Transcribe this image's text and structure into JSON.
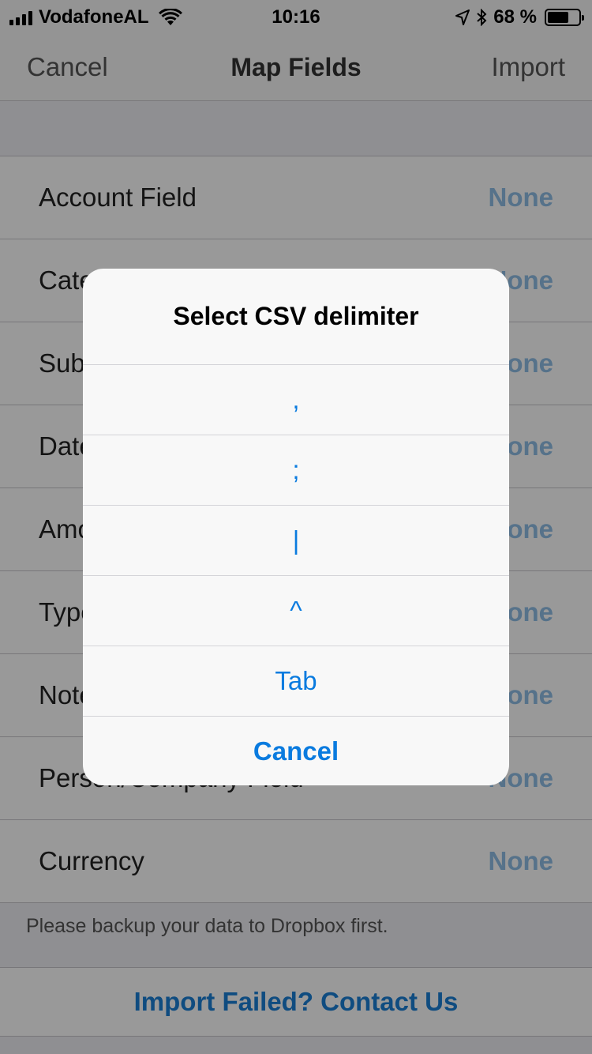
{
  "status_bar": {
    "carrier": "VodafoneAL",
    "time": "10:16",
    "battery": "68 %",
    "battery_level": 0.68
  },
  "nav": {
    "cancel": "Cancel",
    "title": "Map Fields",
    "import": "Import"
  },
  "fields": [
    {
      "label": "Account Field",
      "value": "None"
    },
    {
      "label": "Category Field",
      "value": "None"
    },
    {
      "label": "Subcategory Field",
      "value": "None"
    },
    {
      "label": "Date Field",
      "value": "None"
    },
    {
      "label": "Amount Field",
      "value": "None"
    },
    {
      "label": "Type Field",
      "value": "None"
    },
    {
      "label": "Notes Field",
      "value": "None"
    },
    {
      "label": "Person/Company Field",
      "value": "None"
    },
    {
      "label": "Currency",
      "value": "None"
    }
  ],
  "footer_note": "Please backup your data to Dropbox first.",
  "contact_link": "Import Failed? Contact Us",
  "alert": {
    "title": "Select CSV delimiter",
    "options": [
      ",",
      ";",
      "|",
      "^",
      "Tab"
    ],
    "cancel": "Cancel"
  },
  "colors": {
    "accent": "#0a7bdf",
    "link": "#1a7fd6",
    "value_text": "#8fbfe6"
  }
}
